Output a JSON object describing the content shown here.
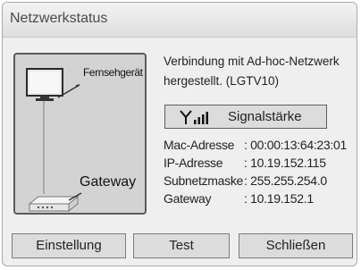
{
  "dialog": {
    "title": "Netzwerkstatus"
  },
  "diagram": {
    "tv_label": "Fernsehgerät",
    "gateway_label": "Gateway",
    "tv_icon": "tv-icon",
    "gateway_icon": "router-icon"
  },
  "status": {
    "connection_text": "Verbindung mit Ad-hoc-Netzwerk hergestellt. (LGTV10)",
    "signal_button": "Signalstärke",
    "signal_icon": "signal-strength-icon"
  },
  "network_info": [
    {
      "label": "Mac-Adresse",
      "value": ": 00:00:13:64:23:01"
    },
    {
      "label": "IP-Adresse",
      "value": ": 10.19.152.115"
    },
    {
      "label": "Subnetzmaske",
      "value": ": 255.255.254.0"
    },
    {
      "label": "Gateway",
      "value": ": 10.19.152.1"
    }
  ],
  "buttons": {
    "settings": "Einstellung",
    "test": "Test",
    "close": "Schließen"
  },
  "colors": {
    "dialog_bg": "#efefef",
    "panel_bg": "#d3d3d3",
    "button_bg": "#dcdcdc",
    "border_dark": "#5a5a5a",
    "text": "#222222"
  }
}
